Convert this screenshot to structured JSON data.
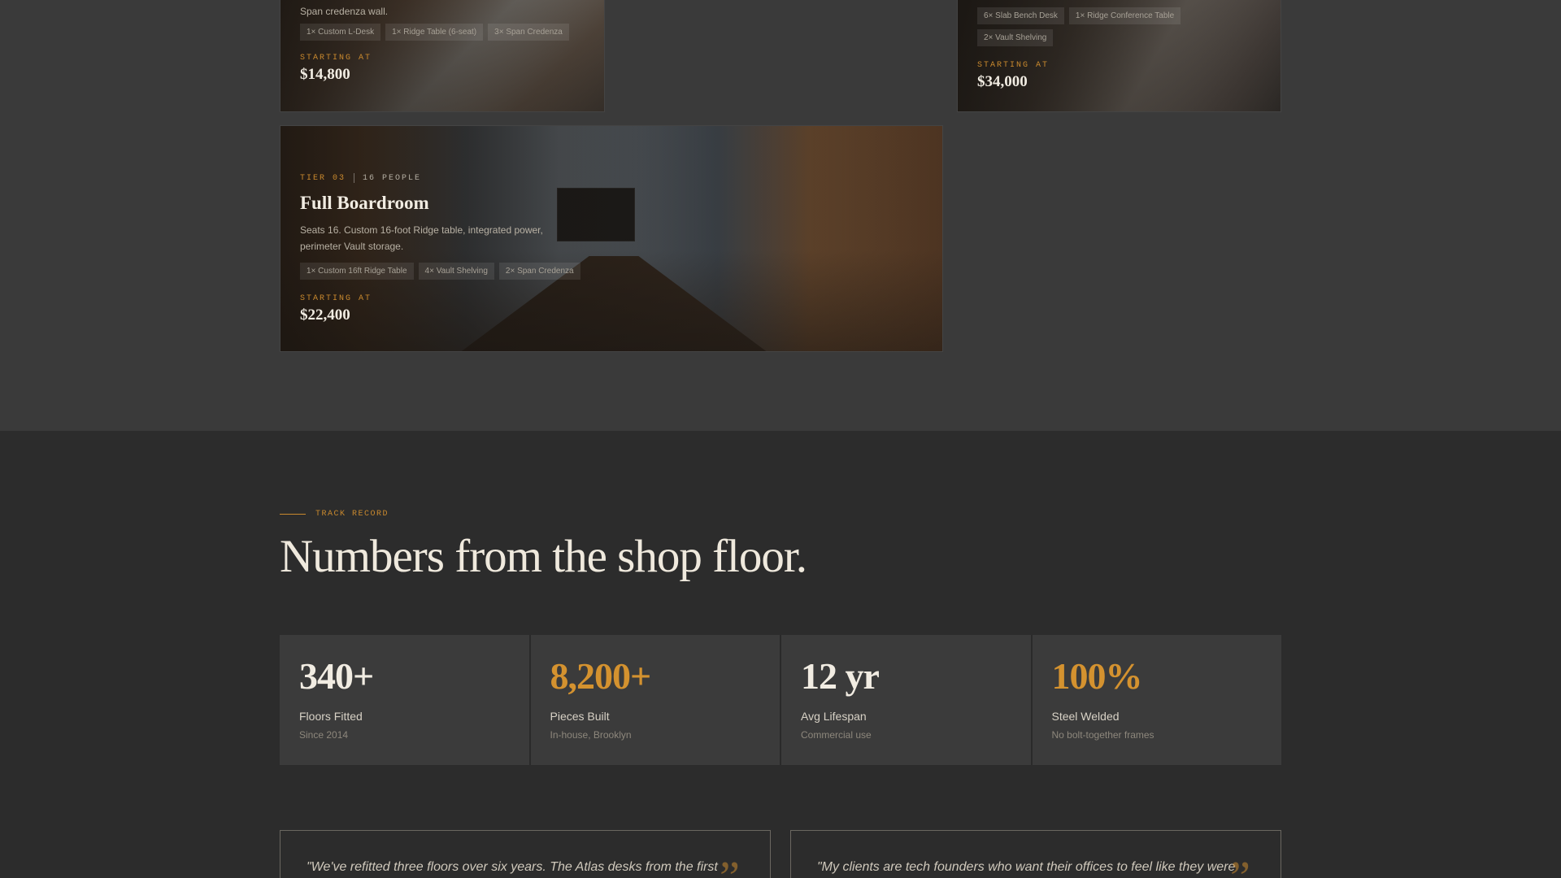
{
  "cards": [
    {
      "desc": "Span credenza wall.",
      "chips": [
        "1× Custom L-Desk",
        "1× Ridge Table (6-seat)",
        "3× Span Credenza"
      ],
      "start_label": "STARTING AT",
      "price": "$14,800"
    },
    {
      "chips": [
        "6× Slab Bench Desk",
        "1× Ridge Conference Table",
        "2× Vault Shelving"
      ],
      "start_label": "STARTING AT",
      "price": "$34,000"
    },
    {
      "tier": "TIER 03",
      "people": "16 PEOPLE",
      "title": "Full Boardroom",
      "desc": "Seats 16. Custom 16-foot Ridge table, integrated power, perimeter Vault storage.",
      "chips": [
        "1× Custom 16ft Ridge Table",
        "4× Vault Shelving",
        "2× Span Credenza"
      ],
      "start_label": "STARTING AT",
      "price": "$22,400"
    }
  ],
  "track_record": {
    "eyebrow": "TRACK RECORD",
    "title": "Numbers from the shop floor.",
    "stats": [
      {
        "value": "340+",
        "label": "Floors Fitted",
        "sub": "Since 2014"
      },
      {
        "value": "8,200+",
        "label": "Pieces Built",
        "sub": "In-house, Brooklyn"
      },
      {
        "value": "12 yr",
        "label": "Avg Lifespan",
        "sub": "Commercial use"
      },
      {
        "value": "100%",
        "label": "Steel Welded",
        "sub": "No bolt-together frames"
      }
    ]
  },
  "testimonials": [
    {
      "text": "\"We've refitted three floors over six years. The Atlas desks from the first",
      "mark": "”"
    },
    {
      "text": "\"My clients are tech founders who want their offices to feel like they were",
      "mark": "”"
    }
  ],
  "colors": {
    "accent": "#c9892e",
    "upper_bg": "#3a3a3a",
    "lower_bg": "#2c2c2c"
  }
}
